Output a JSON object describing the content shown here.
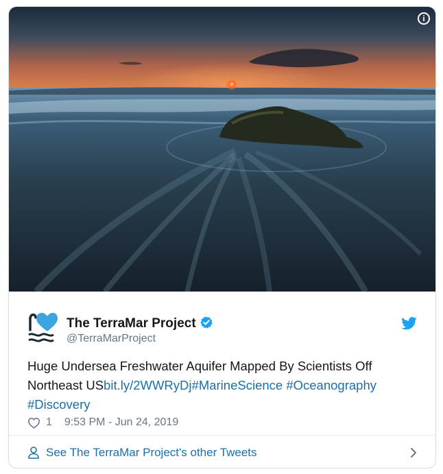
{
  "media": {
    "image_label": "sunset-over-ocean-waves-with-rock-photo"
  },
  "tweet": {
    "display_name": "The TerraMar Project",
    "handle": "@TerraMarProject",
    "text_prefix": "Huge Undersea Freshwater Aquifer Mapped By Scientists Off Northeast US",
    "link": "bit.ly/2WWRyDj",
    "hashtags": [
      "#MarineScience",
      "#Oceanography",
      "#Discovery"
    ],
    "like_count": "1",
    "timestamp": "9:53 PM - Jun 24, 2019"
  },
  "footer": {
    "label": "See The TerraMar Project's other Tweets"
  },
  "colors": {
    "link": "#1b6fa8",
    "twitter_blue": "#1da1f2",
    "secondary_text": "#657786"
  },
  "icons": {
    "info": "info-icon",
    "verified": "verified-badge-icon",
    "twitter": "twitter-bird-icon",
    "like": "heart-icon",
    "profile": "person-icon",
    "more": "chevron-right-icon"
  }
}
